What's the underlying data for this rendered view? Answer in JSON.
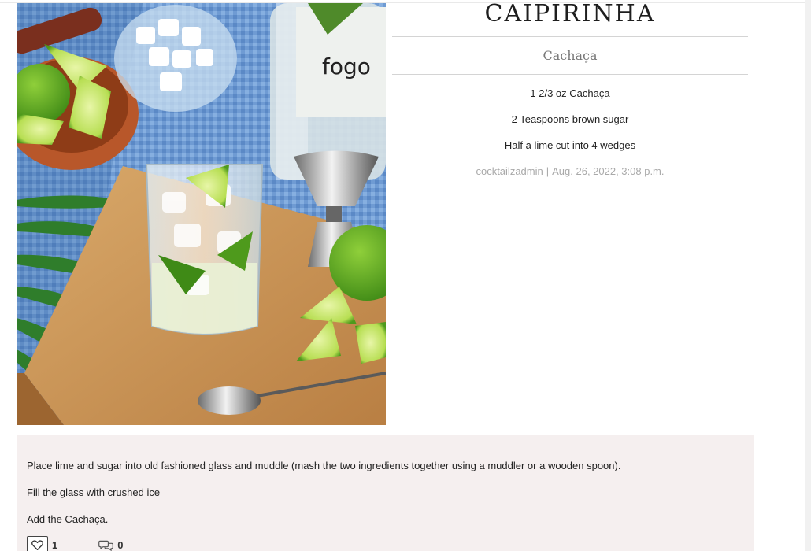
{
  "recipe": {
    "title": "CAIPIRINHA",
    "category": "Cachaça",
    "ingredients": [
      "1 2/3 oz Cachaça",
      "2 Teaspoons brown sugar",
      "Half a lime cut into 4 wedges"
    ],
    "author": "cocktailzadmin",
    "separator": "|",
    "date": "Aug. 26, 2022, 3:08 p.m.",
    "bottle_label": "fogo"
  },
  "instructions": [
    "Place lime and sugar into old fashioned glass and muddle (mash the two ingredients together using a muddler or a wooden spoon).",
    "Fill the glass with crushed ice",
    "Add the Cachaça."
  ],
  "actions": {
    "likes": "1",
    "comments": "0",
    "like_icon": "heart-icon",
    "comment_icon": "comment-bubbles-icon"
  },
  "colors": {
    "instructions_bg": "#f5efef",
    "meta_text": "#a9a9a9",
    "photo_bg": "#6f9bd3"
  }
}
